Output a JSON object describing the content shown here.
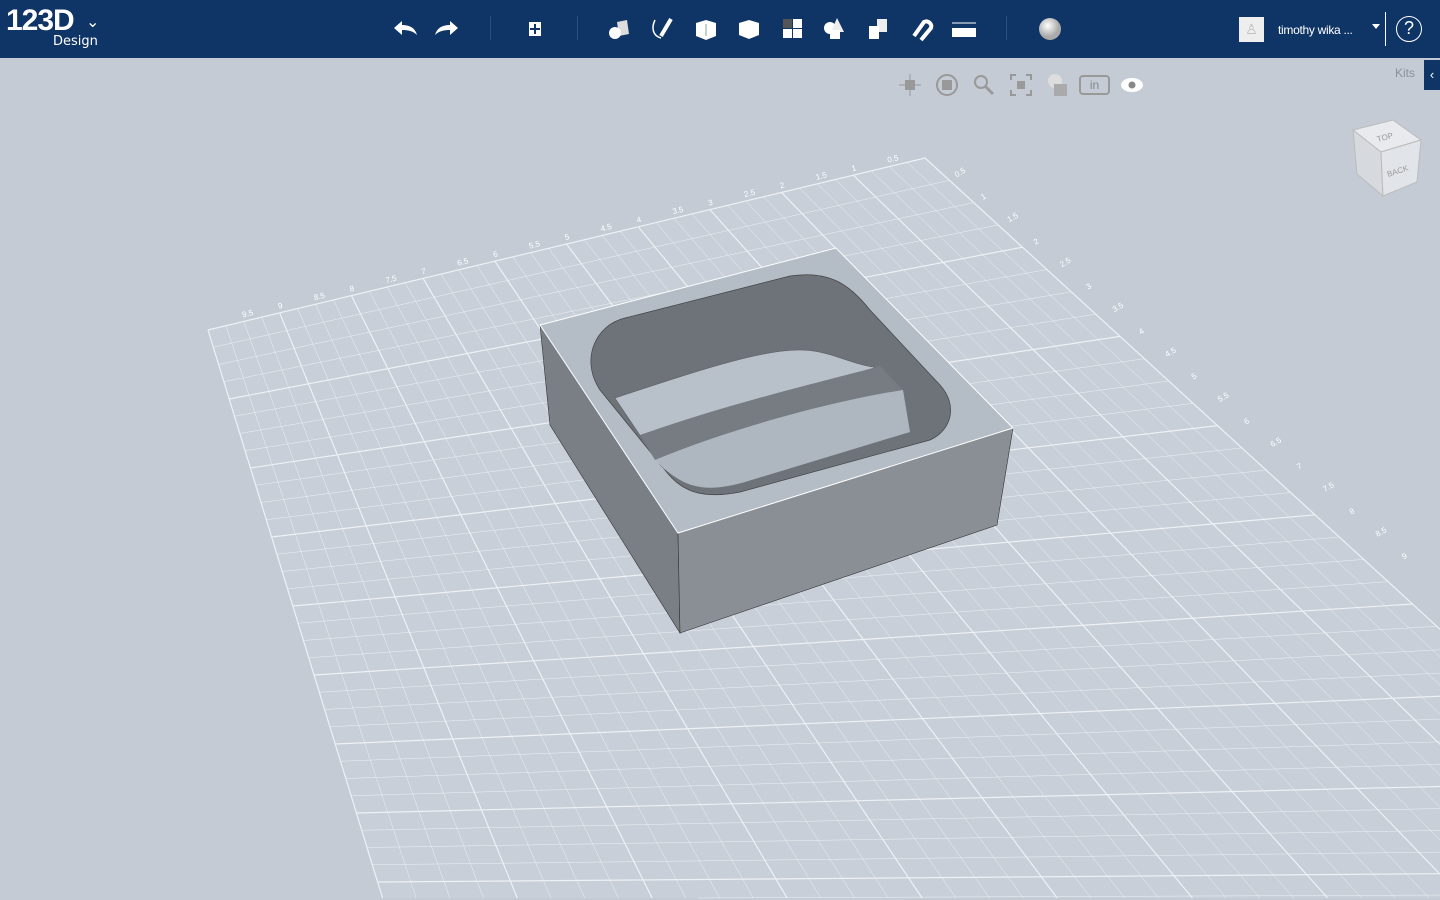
{
  "app": {
    "logo": "123D",
    "logo_sub": "Design",
    "user_name": "timothy wika ...",
    "help": "?",
    "kits": "Kits"
  },
  "toolbar": [
    "undo-icon",
    "redo-icon",
    "transform-icon",
    "primitives-icon",
    "sketch-icon",
    "construct-icon",
    "modify-icon",
    "pattern-icon",
    "group-icon",
    "combine-icon",
    "snap-icon",
    "measure-icon",
    "material-icon"
  ],
  "view_controls": [
    "pan-icon",
    "orbit-icon",
    "zoom-icon",
    "fit-icon",
    "view-mode-icon",
    "units-icon",
    "visibility-icon"
  ],
  "units": "in",
  "viewcube": {
    "top": "TOP",
    "back": "BACK"
  },
  "grid_labels": {
    "back_edge": [
      "9.5",
      "9",
      "8.5",
      "8",
      "7.5",
      "7",
      "6.5",
      "6",
      "5.5",
      "5",
      "4.5",
      "4",
      "3.5",
      "3",
      "2.5",
      "2",
      "1.5",
      "1",
      "0.5"
    ],
    "right_edge": [
      "0.5",
      "1",
      "1.5",
      "2",
      "2.5",
      "3",
      "3.5",
      "4",
      "4.5",
      "5",
      "5.5",
      "6",
      "6.5",
      "7",
      "7.5",
      "8",
      "8.5",
      "9"
    ]
  }
}
